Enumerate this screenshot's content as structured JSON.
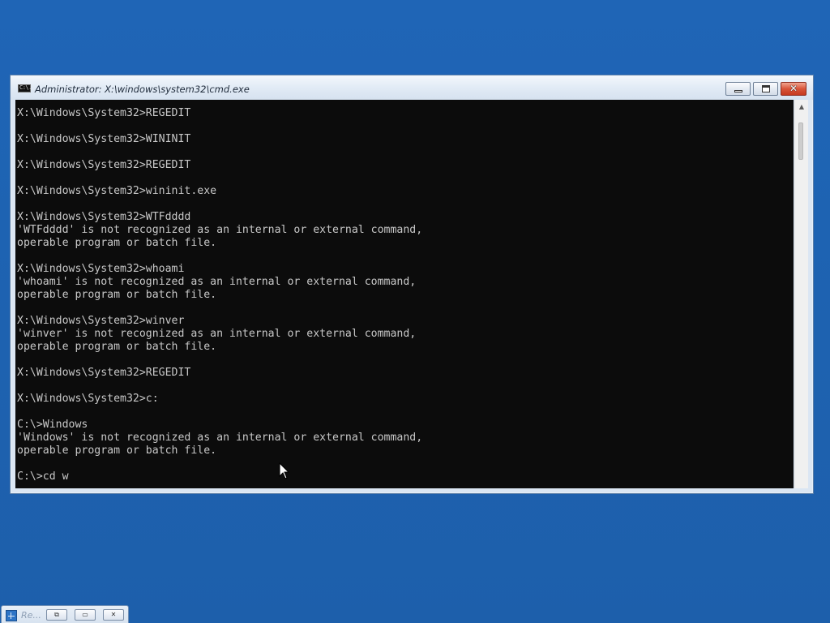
{
  "window": {
    "title": "Administrator: X:\\windows\\system32\\cmd.exe",
    "icon": "console-icon",
    "icon_text": "C:\\.",
    "buttons": {
      "minimize_icon": "minimize-icon",
      "maximize_icon": "maximize-icon",
      "close_icon": "close-icon",
      "close_label": "✕"
    }
  },
  "console": {
    "text_color": "#c8c8c8",
    "background_color": "#0c0c0c",
    "lines": [
      "X:\\Windows\\System32>REGEDIT",
      "",
      "X:\\Windows\\System32>WININIT",
      "",
      "X:\\Windows\\System32>REGEDIT",
      "",
      "X:\\Windows\\System32>wininit.exe",
      "",
      "X:\\Windows\\System32>WTFdddd",
      "'WTFdddd' is not recognized as an internal or external command,",
      "operable program or batch file.",
      "",
      "X:\\Windows\\System32>whoami",
      "'whoami' is not recognized as an internal or external command,",
      "operable program or batch file.",
      "",
      "X:\\Windows\\System32>winver",
      "'winver' is not recognized as an internal or external command,",
      "operable program or batch file.",
      "",
      "X:\\Windows\\System32>REGEDIT",
      "",
      "X:\\Windows\\System32>c:",
      "",
      "C:\\>Windows",
      "'Windows' is not recognized as an internal or external command,",
      "operable program or batch file.",
      "",
      "C:\\>cd w"
    ]
  },
  "scrollbar": {
    "up_arrow_icon": "scroll-up-arrow-icon",
    "up_arrow_glyph": "▲"
  },
  "taskbar_tile": {
    "label": "Re...",
    "icon": "regedit-icon",
    "restore_icon": "restore-icon",
    "restore_glyph": "⧉",
    "maximize_icon": "maximize-icon",
    "maximize_glyph": "▭",
    "close_icon": "close-icon",
    "close_glyph": "✕"
  },
  "colors": {
    "desktop": "#1f63b3",
    "titlebar": "#dbe6f3",
    "close_button": "#c5391f"
  }
}
